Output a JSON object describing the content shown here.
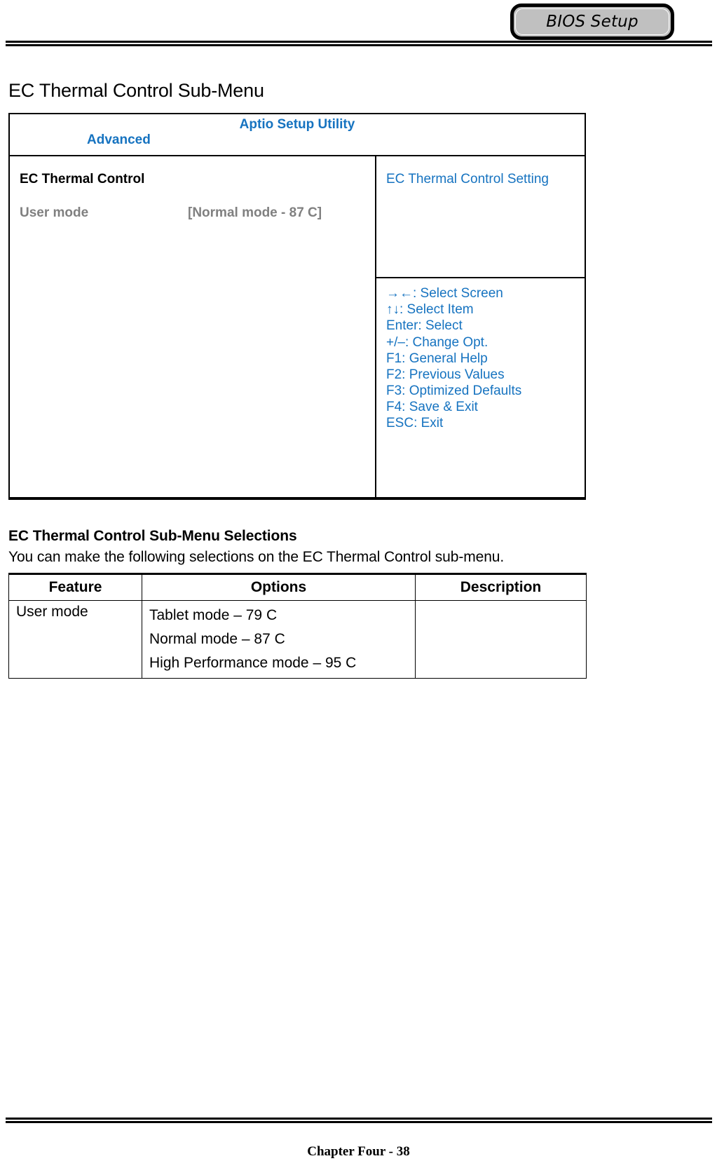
{
  "header": {
    "tab_label": "BIOS Setup"
  },
  "page": {
    "section_title": "EC Thermal Control Sub-Menu",
    "footer": "Chapter Four - 38"
  },
  "bios": {
    "utility_name": "Aptio Setup Utility",
    "menu_tab": "Advanced",
    "group_heading": "EC Thermal Control",
    "option": {
      "label": "User mode",
      "value": "[Normal mode - 87 C]"
    },
    "help_text": "EC Thermal Control Setting",
    "help_keys": [
      "→←: Select Screen",
      "↑↓: Select Item",
      "Enter: Select",
      "+/–: Change Opt.",
      "F1: General Help",
      "F2: Previous Values",
      "F3: Optimized Defaults",
      "F4: Save & Exit",
      "ESC: Exit"
    ],
    "accent_color": "#1673c0",
    "dim_color": "#808080"
  },
  "selections": {
    "heading": "EC Thermal Control Sub-Menu Selections",
    "intro": "You can make the following selections on the EC Thermal Control sub-menu.",
    "columns": [
      "Feature",
      "Options",
      "Description"
    ],
    "rows": [
      {
        "feature": "User mode",
        "options": [
          "Tablet mode – 79 C",
          "Normal mode – 87 C",
          "High Performance mode – 95 C"
        ],
        "description": ""
      }
    ]
  }
}
